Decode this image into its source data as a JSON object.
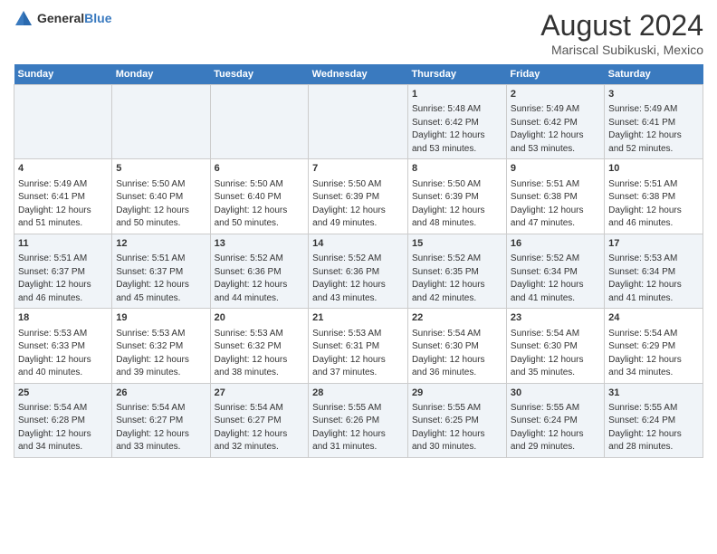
{
  "logo": {
    "text_general": "General",
    "text_blue": "Blue"
  },
  "title": "August 2024",
  "subtitle": "Mariscal Subikuski, Mexico",
  "days_of_week": [
    "Sunday",
    "Monday",
    "Tuesday",
    "Wednesday",
    "Thursday",
    "Friday",
    "Saturday"
  ],
  "weeks": [
    [
      {
        "day": "",
        "content": ""
      },
      {
        "day": "",
        "content": ""
      },
      {
        "day": "",
        "content": ""
      },
      {
        "day": "",
        "content": ""
      },
      {
        "day": "1",
        "content": "Sunrise: 5:48 AM\nSunset: 6:42 PM\nDaylight: 12 hours\nand 53 minutes."
      },
      {
        "day": "2",
        "content": "Sunrise: 5:49 AM\nSunset: 6:42 PM\nDaylight: 12 hours\nand 53 minutes."
      },
      {
        "day": "3",
        "content": "Sunrise: 5:49 AM\nSunset: 6:41 PM\nDaylight: 12 hours\nand 52 minutes."
      }
    ],
    [
      {
        "day": "4",
        "content": "Sunrise: 5:49 AM\nSunset: 6:41 PM\nDaylight: 12 hours\nand 51 minutes."
      },
      {
        "day": "5",
        "content": "Sunrise: 5:50 AM\nSunset: 6:40 PM\nDaylight: 12 hours\nand 50 minutes."
      },
      {
        "day": "6",
        "content": "Sunrise: 5:50 AM\nSunset: 6:40 PM\nDaylight: 12 hours\nand 50 minutes."
      },
      {
        "day": "7",
        "content": "Sunrise: 5:50 AM\nSunset: 6:39 PM\nDaylight: 12 hours\nand 49 minutes."
      },
      {
        "day": "8",
        "content": "Sunrise: 5:50 AM\nSunset: 6:39 PM\nDaylight: 12 hours\nand 48 minutes."
      },
      {
        "day": "9",
        "content": "Sunrise: 5:51 AM\nSunset: 6:38 PM\nDaylight: 12 hours\nand 47 minutes."
      },
      {
        "day": "10",
        "content": "Sunrise: 5:51 AM\nSunset: 6:38 PM\nDaylight: 12 hours\nand 46 minutes."
      }
    ],
    [
      {
        "day": "11",
        "content": "Sunrise: 5:51 AM\nSunset: 6:37 PM\nDaylight: 12 hours\nand 46 minutes."
      },
      {
        "day": "12",
        "content": "Sunrise: 5:51 AM\nSunset: 6:37 PM\nDaylight: 12 hours\nand 45 minutes."
      },
      {
        "day": "13",
        "content": "Sunrise: 5:52 AM\nSunset: 6:36 PM\nDaylight: 12 hours\nand 44 minutes."
      },
      {
        "day": "14",
        "content": "Sunrise: 5:52 AM\nSunset: 6:36 PM\nDaylight: 12 hours\nand 43 minutes."
      },
      {
        "day": "15",
        "content": "Sunrise: 5:52 AM\nSunset: 6:35 PM\nDaylight: 12 hours\nand 42 minutes."
      },
      {
        "day": "16",
        "content": "Sunrise: 5:52 AM\nSunset: 6:34 PM\nDaylight: 12 hours\nand 41 minutes."
      },
      {
        "day": "17",
        "content": "Sunrise: 5:53 AM\nSunset: 6:34 PM\nDaylight: 12 hours\nand 41 minutes."
      }
    ],
    [
      {
        "day": "18",
        "content": "Sunrise: 5:53 AM\nSunset: 6:33 PM\nDaylight: 12 hours\nand 40 minutes."
      },
      {
        "day": "19",
        "content": "Sunrise: 5:53 AM\nSunset: 6:32 PM\nDaylight: 12 hours\nand 39 minutes."
      },
      {
        "day": "20",
        "content": "Sunrise: 5:53 AM\nSunset: 6:32 PM\nDaylight: 12 hours\nand 38 minutes."
      },
      {
        "day": "21",
        "content": "Sunrise: 5:53 AM\nSunset: 6:31 PM\nDaylight: 12 hours\nand 37 minutes."
      },
      {
        "day": "22",
        "content": "Sunrise: 5:54 AM\nSunset: 6:30 PM\nDaylight: 12 hours\nand 36 minutes."
      },
      {
        "day": "23",
        "content": "Sunrise: 5:54 AM\nSunset: 6:30 PM\nDaylight: 12 hours\nand 35 minutes."
      },
      {
        "day": "24",
        "content": "Sunrise: 5:54 AM\nSunset: 6:29 PM\nDaylight: 12 hours\nand 34 minutes."
      }
    ],
    [
      {
        "day": "25",
        "content": "Sunrise: 5:54 AM\nSunset: 6:28 PM\nDaylight: 12 hours\nand 34 minutes."
      },
      {
        "day": "26",
        "content": "Sunrise: 5:54 AM\nSunset: 6:27 PM\nDaylight: 12 hours\nand 33 minutes."
      },
      {
        "day": "27",
        "content": "Sunrise: 5:54 AM\nSunset: 6:27 PM\nDaylight: 12 hours\nand 32 minutes."
      },
      {
        "day": "28",
        "content": "Sunrise: 5:55 AM\nSunset: 6:26 PM\nDaylight: 12 hours\nand 31 minutes."
      },
      {
        "day": "29",
        "content": "Sunrise: 5:55 AM\nSunset: 6:25 PM\nDaylight: 12 hours\nand 30 minutes."
      },
      {
        "day": "30",
        "content": "Sunrise: 5:55 AM\nSunset: 6:24 PM\nDaylight: 12 hours\nand 29 minutes."
      },
      {
        "day": "31",
        "content": "Sunrise: 5:55 AM\nSunset: 6:24 PM\nDaylight: 12 hours\nand 28 minutes."
      }
    ]
  ]
}
